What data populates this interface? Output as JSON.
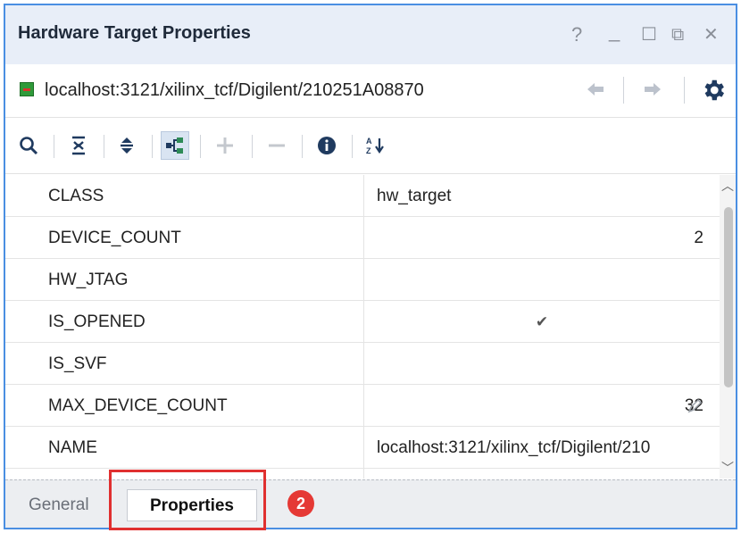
{
  "window": {
    "title": "Hardware Target Properties",
    "controls": {
      "help": "?",
      "minimize": "_",
      "maximize": "☐",
      "float": "⧉",
      "close": "✕"
    }
  },
  "path": {
    "text": "localhost:3121/xilinx_tcf/Digilent/210251A08870",
    "back_icon": "arrow-left-icon",
    "forward_icon": "arrow-right-icon",
    "settings_icon": "gear-icon"
  },
  "toolbar": {
    "buttons": [
      {
        "icon": "search-icon"
      },
      {
        "icon": "collapse-all-icon"
      },
      {
        "icon": "expand-all-icon"
      },
      {
        "icon": "group-by-category-icon",
        "active": true
      },
      {
        "icon": "plus-icon"
      },
      {
        "icon": "minus-icon"
      },
      {
        "icon": "info-icon"
      },
      {
        "icon": "sort-az-icon"
      }
    ],
    "sort_label": "A Z"
  },
  "properties": [
    {
      "name": "CLASS",
      "value": "hw_target",
      "align": "left"
    },
    {
      "name": "DEVICE_COUNT",
      "value": "2",
      "align": "right"
    },
    {
      "name": "HW_JTAG",
      "value": "",
      "align": "left"
    },
    {
      "name": "IS_OPENED",
      "value": "✔",
      "align": "center"
    },
    {
      "name": "IS_SVF",
      "value": "",
      "align": "left"
    },
    {
      "name": "MAX_DEVICE_COUNT",
      "value": "32",
      "align": "right"
    },
    {
      "name": "NAME",
      "value": "localhost:3121/xilinx_tcf/Digilent/210",
      "align": "left"
    }
  ],
  "tabs": {
    "general": "General",
    "properties": "Properties",
    "selected": "Properties"
  },
  "callout": {
    "number": "2"
  },
  "colors": {
    "accent": "#4a8fe2",
    "title_bg": "#e8eef8",
    "highlight": "#e03030",
    "badge": "#e53935"
  }
}
